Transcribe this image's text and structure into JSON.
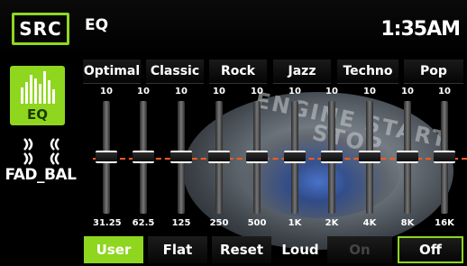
{
  "header": {
    "src_label": "SRC",
    "title": "EQ",
    "clock": "1:35AM"
  },
  "sidebar": {
    "eq_label": "EQ",
    "fadbal_label": "FAD_BAL",
    "active_color": "#8fd61f"
  },
  "background_text": "ENGINE START STOP",
  "presets": [
    "Optimal",
    "Classic",
    "Rock",
    "Jazz",
    "Techno",
    "Pop"
  ],
  "bands": [
    {
      "top": "10",
      "freq": "31.25"
    },
    {
      "top": "10",
      "freq": "62.5"
    },
    {
      "top": "10",
      "freq": "125"
    },
    {
      "top": "10",
      "freq": "250"
    },
    {
      "top": "10",
      "freq": "500"
    },
    {
      "top": "10",
      "freq": "1K"
    },
    {
      "top": "10",
      "freq": "2K"
    },
    {
      "top": "10",
      "freq": "4K"
    },
    {
      "top": "10",
      "freq": "8K"
    },
    {
      "top": "10",
      "freq": "16K"
    }
  ],
  "bottom": {
    "user": "User",
    "flat": "Flat",
    "reset": "Reset",
    "loud": "Loud",
    "on": "On",
    "off": "Off"
  }
}
